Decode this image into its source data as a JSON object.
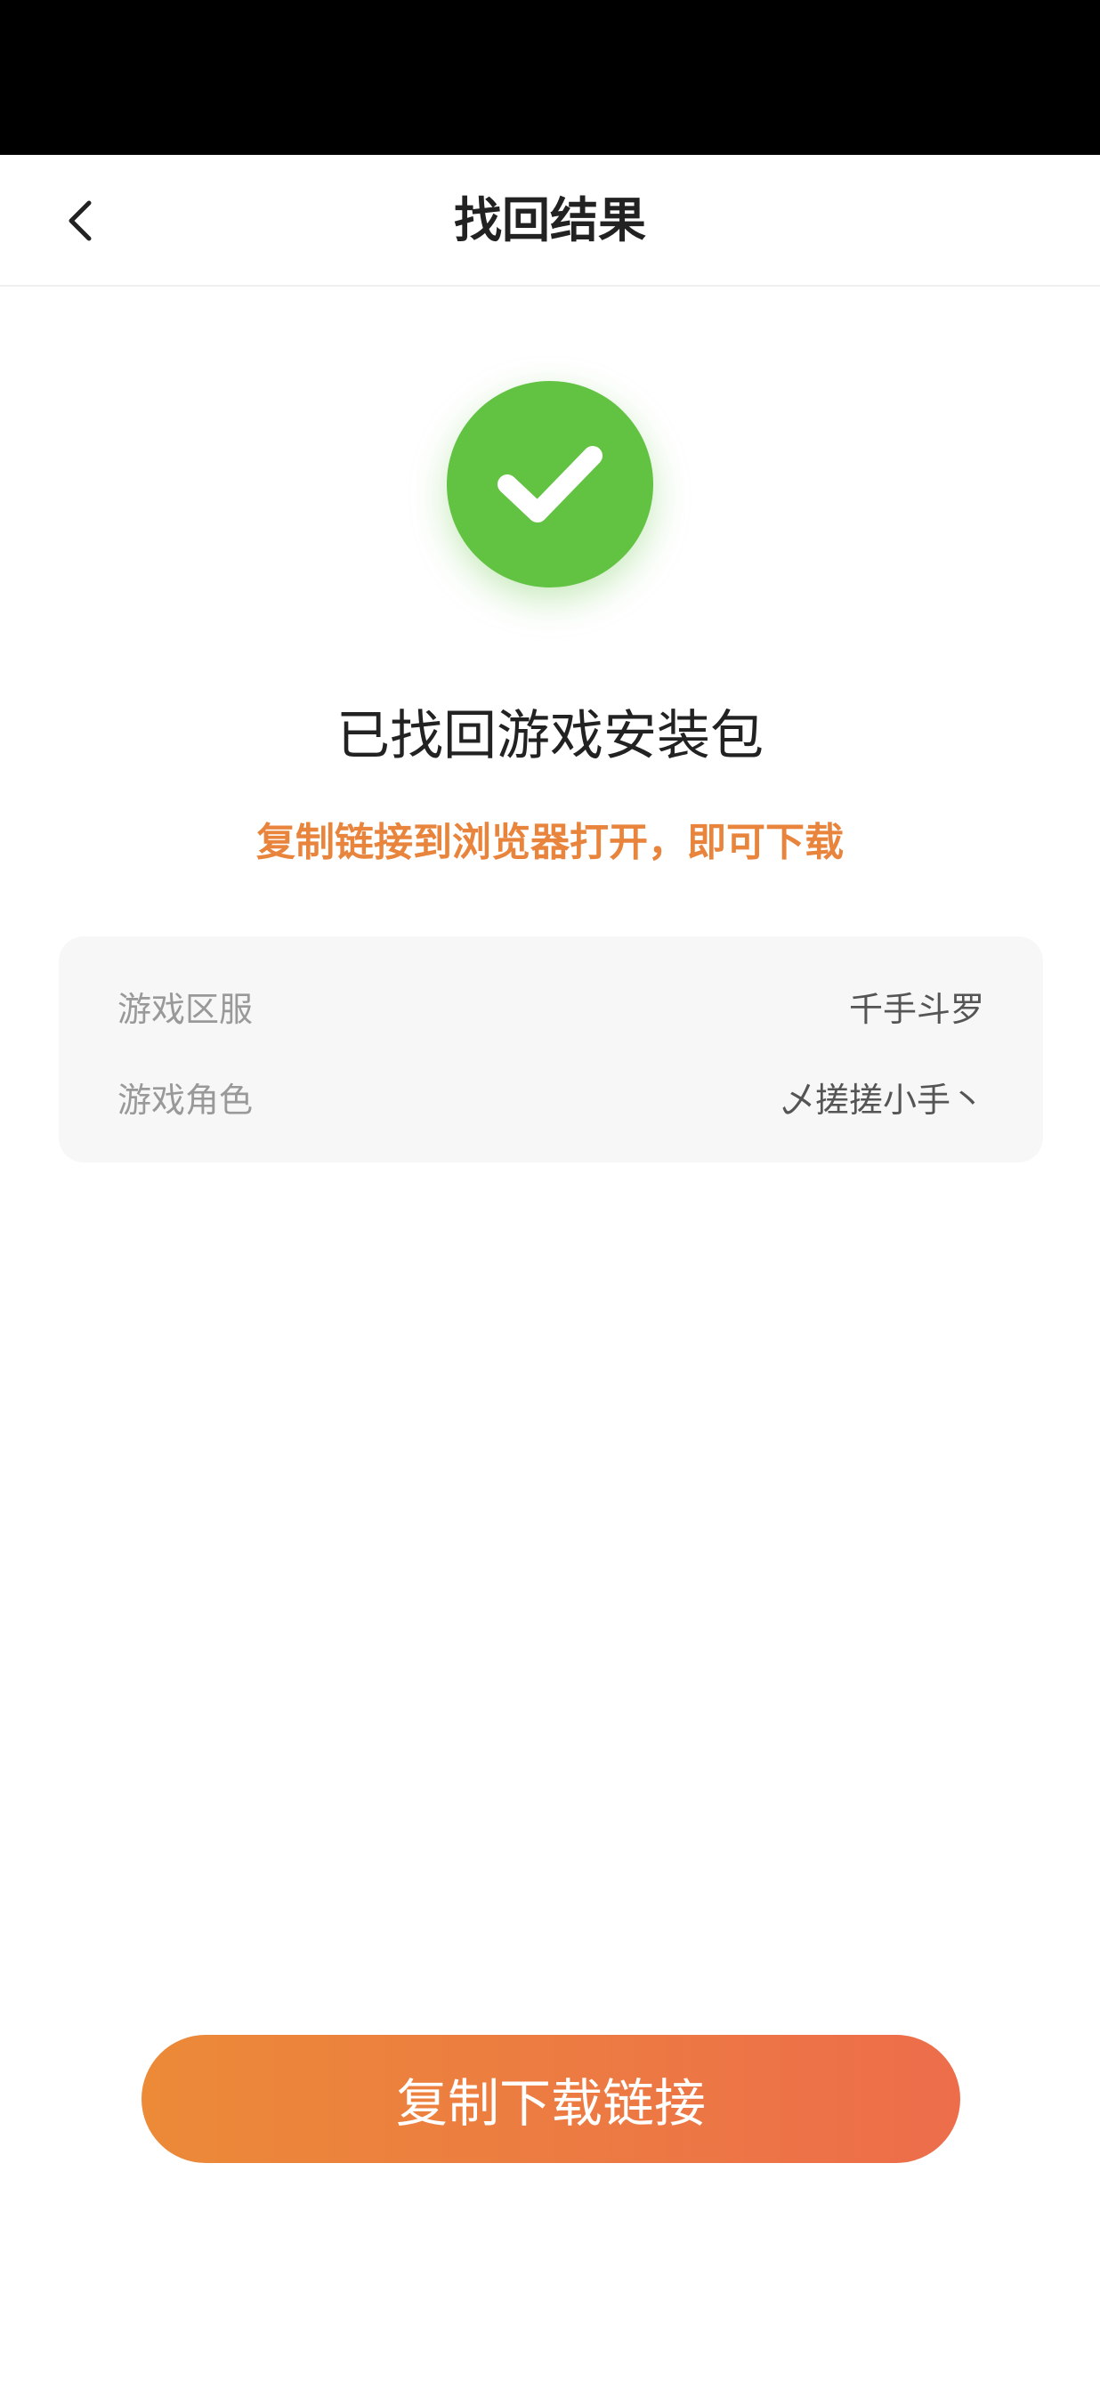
{
  "nav": {
    "title": "找回结果",
    "back_icon": "chevron-left-icon"
  },
  "result": {
    "icon": "checkmark-icon",
    "title": "已找回游戏安装包",
    "hint": "复制链接到浏览器打开，即可下载"
  },
  "info": {
    "rows": [
      {
        "label": "游戏区服",
        "value": "千手斗罗"
      },
      {
        "label": "游戏角色",
        "value": "乄搓搓小手丶"
      }
    ]
  },
  "actions": {
    "copy_button_label": "复制下载链接"
  },
  "colors": {
    "success": "#62c242",
    "accent": "#e8843c",
    "button_gradient_start": "#ec8a38",
    "button_gradient_end": "#ed6d4b"
  }
}
